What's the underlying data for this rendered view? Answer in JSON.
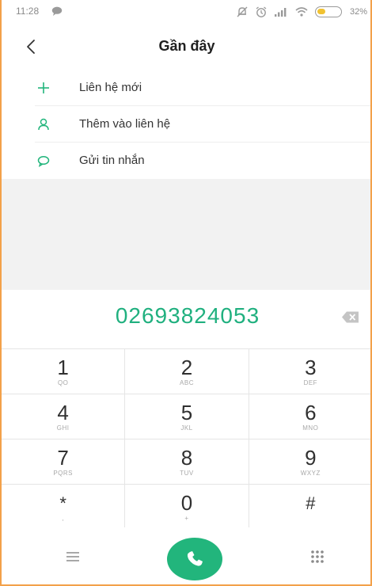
{
  "status_bar": {
    "time": "11:28",
    "battery_percent": "32%",
    "battery_level": 0.32,
    "icons": [
      "message-icon",
      "mute-icon",
      "alarm-icon",
      "signal-icon",
      "wifi-icon",
      "battery-icon"
    ]
  },
  "header": {
    "title": "Gần đây",
    "back_icon": "back-arrow-icon"
  },
  "actions": [
    {
      "icon": "plus-icon",
      "label": "Liên hệ mới"
    },
    {
      "icon": "person-icon",
      "label": "Thêm vào liên hệ"
    },
    {
      "icon": "message-bubble-icon",
      "label": "Gửi tin nhắn"
    }
  ],
  "dialer": {
    "number": "02693824053",
    "backspace_icon": "backspace-icon"
  },
  "keypad": {
    "rows": [
      [
        {
          "digit": "1",
          "letters": "QO"
        },
        {
          "digit": "2",
          "letters": "ABC"
        },
        {
          "digit": "3",
          "letters": "DEF"
        }
      ],
      [
        {
          "digit": "4",
          "letters": "GHI"
        },
        {
          "digit": "5",
          "letters": "JKL"
        },
        {
          "digit": "6",
          "letters": "MNO"
        }
      ],
      [
        {
          "digit": "7",
          "letters": "PQRS"
        },
        {
          "digit": "8",
          "letters": "TUV"
        },
        {
          "digit": "9",
          "letters": "WXYZ"
        }
      ],
      [
        {
          "digit": "*",
          "letters": ","
        },
        {
          "digit": "0",
          "letters": "+"
        },
        {
          "digit": "#",
          "letters": ""
        }
      ]
    ]
  },
  "bottom_bar": {
    "menu_icon": "menu-icon",
    "call_icon": "phone-icon",
    "keypad_icon": "dialpad-icon"
  },
  "colors": {
    "accent": "#22b57c",
    "number_text": "#20b07f",
    "frame_border": "#f3a14a",
    "blank_area": "#f2f2f2"
  }
}
